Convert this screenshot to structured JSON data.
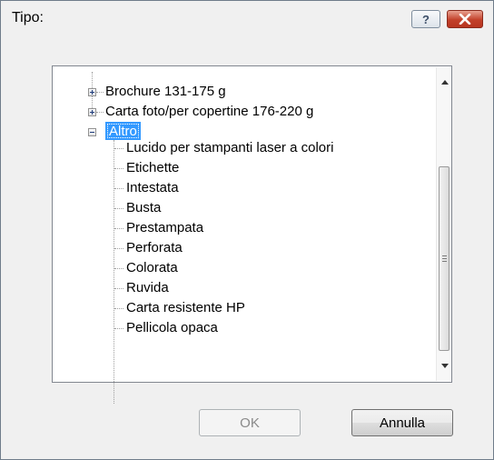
{
  "window": {
    "title": "Tipo:",
    "help_glyph": "?",
    "help_icon": "question-mark-icon",
    "close_icon": "close-x-icon"
  },
  "tree": {
    "collapsed_nodes": [
      {
        "label": "Brochure 131-175 g"
      },
      {
        "label": "Carta foto/per copertine 176-220 g"
      }
    ],
    "expanded_node": {
      "label": "Altro",
      "selected": true,
      "children": [
        "Lucido per stampanti laser a colori",
        "Etichette",
        "Intestata",
        "Busta",
        "Prestampata",
        "Perforata",
        "Colorata",
        "Ruvida",
        "Carta resistente HP",
        "Pellicola opaca"
      ]
    }
  },
  "scrollbar": {
    "position_fraction": 0.45
  },
  "buttons": {
    "ok_label": "OK",
    "ok_enabled": false,
    "cancel_label": "Annulla"
  },
  "colors": {
    "selection": "#3399ff",
    "close_button": "#c2402a"
  }
}
